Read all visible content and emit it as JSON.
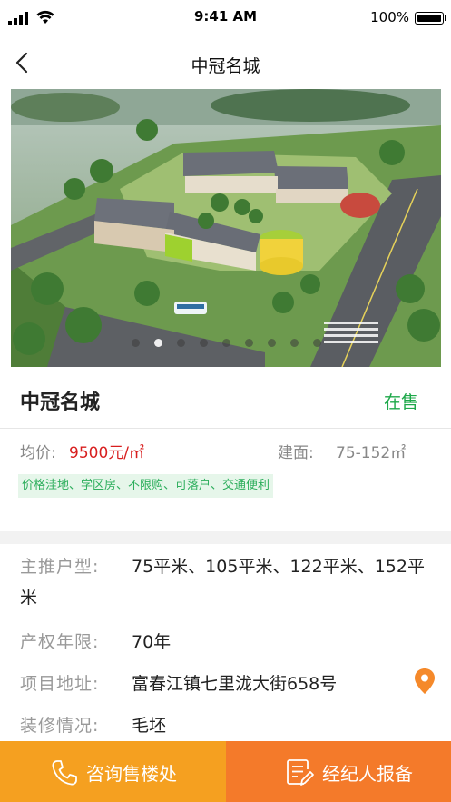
{
  "status_bar": {
    "time": "9:41 AM",
    "battery": "100%"
  },
  "nav": {
    "title": "中冠名城",
    "back_icon": "chevron-left-icon"
  },
  "gallery": {
    "image": "aerial rendering of school campus",
    "slide_count": 9,
    "active_slide": 1
  },
  "project": {
    "name": "中冠名城",
    "sale_status": "在售",
    "sale_status_color": "#1ea84a"
  },
  "price": {
    "avg_label": "均价:",
    "avg_value": "9500元/㎡",
    "avg_color": "#d81e1e",
    "area_label": "建面:",
    "area_value": "75-152㎡"
  },
  "tags": "价格洼地、学区房、不限购、可落户、交通便利",
  "info": {
    "layout_label": "主推户型:",
    "layout_value": "75平米、105平米、122平米、152平米",
    "term_label": "产权年限:",
    "term_value": "70年",
    "address_label": "项目地址:",
    "address_value": "富春江镇七里泷大街658号",
    "decor_label": "装修情况:",
    "decor_value": "毛坯",
    "location_icon": "map-pin-icon"
  },
  "actions": {
    "consult_label": "咨询售楼处",
    "consult_icon": "phone-icon",
    "agent_label": "经纪人报备",
    "agent_icon": "edit-document-icon",
    "consult_color": "#f5a020",
    "agent_color": "#f47a2a"
  }
}
